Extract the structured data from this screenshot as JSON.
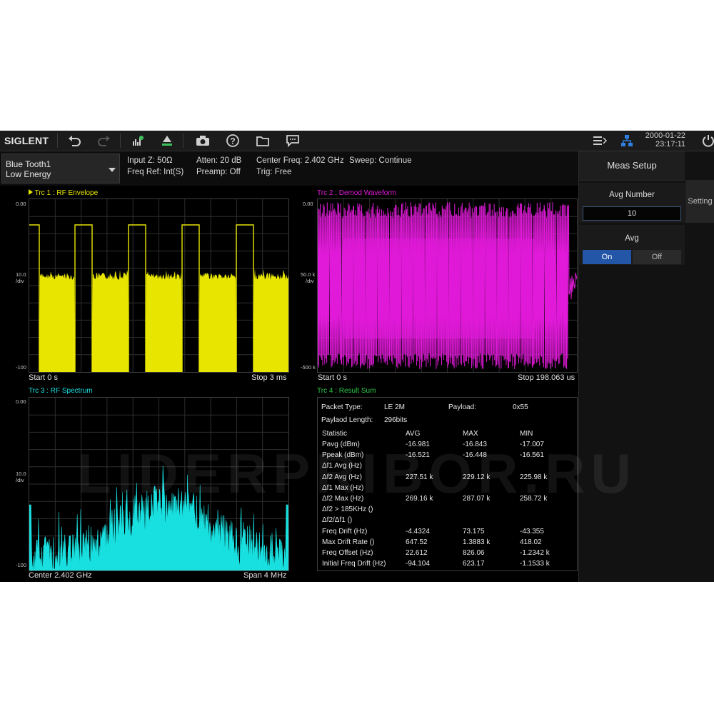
{
  "toolbar": {
    "brand": "SIGLENT",
    "icons": [
      "undo-icon",
      "redo-icon",
      "peak-search-icon",
      "marker-icon",
      "camera-icon",
      "help-icon",
      "folder-icon",
      "message-icon",
      "menu-list-icon",
      "network-icon",
      "power-icon"
    ],
    "date": "2000-01-22",
    "time": "23:17:11"
  },
  "mode": {
    "line1": "Blue Tooth1",
    "line2": "Low Energy"
  },
  "info": {
    "input_z": "Input Z: 50Ω",
    "freq_ref": "Freq Ref: Int(S)",
    "atten": "Atten: 20 dB",
    "preamp": "Preamp: Off",
    "center_freq": "Center Freq: 2.402 GHz",
    "sweep": "Sweep: Continue",
    "trig": "Trig: Free"
  },
  "meas_setup": {
    "title": "Meas Setup",
    "tab": "Setting",
    "avg_number_label": "Avg Number",
    "avg_number_value": "10",
    "avg_label": "Avg",
    "avg_on": "On",
    "avg_off": "Off",
    "avg_state": "On"
  },
  "trace1": {
    "title": "Trc 1 :  RF Envelope",
    "color": "#e8e600",
    "ytop": "0.00",
    "ymid": "10.0",
    "ydiv": "/div",
    "ybot": "-100",
    "start": "Start 0 s",
    "stop": "Stop 3 ms"
  },
  "trace2": {
    "title": "Trc 2 :  Demod Waveform",
    "color": "#e01ad8",
    "ytop": "0.00",
    "ymid": "50.0 k",
    "ydiv": "/div",
    "ybot": "-500 k",
    "start": "Start 0 s",
    "stop": "Stop 198.063 us"
  },
  "trace3": {
    "title": "Trc 3 :  RF Spectrum",
    "color": "#19e0e0",
    "ytop": "0.00",
    "ymid": "10.0",
    "ydiv": "/div",
    "ybot": "-100",
    "center": "Center 2.402 GHz",
    "span": "Span 4 MHz"
  },
  "trace4": {
    "title": "Trc 4 :  Result Sum",
    "color": "#2ec84a",
    "packet_type_label": "Packet Type:",
    "packet_type_value": "LE 2M",
    "payload_label": "Payload:",
    "payload_value": "0x55",
    "payload_length_label": "Paylaod Length:",
    "payload_length_value": "296bits",
    "header": [
      "Statistic",
      "AVG",
      "MAX",
      "MIN"
    ],
    "rows": [
      [
        "Pavg (dBm)",
        "-16.981",
        "-16.843",
        "-17.007"
      ],
      [
        "Ppeak (dBm)",
        "-16.521",
        "-16.448",
        "-16.561"
      ],
      [
        "Δf1 Avg (Hz)",
        "",
        "",
        ""
      ],
      [
        "Δf2 Avg (Hz)",
        "227.51 k",
        "229.12 k",
        "225.98 k"
      ],
      [
        "Δf1 Max (Hz)",
        "",
        "",
        ""
      ],
      [
        "Δf2 Max (Hz)",
        "269.16 k",
        "287.07 k",
        "258.72 k"
      ],
      [
        "Δf2 > 185KHz ()",
        "",
        "",
        ""
      ],
      [
        "Δf2/Δf1 ()",
        "",
        "",
        ""
      ],
      [
        "Freq Drift (Hz)",
        "-4.4324",
        "73.175",
        "-43.355"
      ],
      [
        "Max Drift Rate ()",
        "647.52",
        "1.3883 k",
        "418.02"
      ],
      [
        "Freq Offset (Hz)",
        "22.612",
        "826.06",
        "-1.2342 k"
      ],
      [
        "Initial Freq Drift (Hz)",
        "-94.104",
        "623.17",
        "-1.1533 k"
      ]
    ]
  },
  "watermark": "LIDERPRIBOR.RU"
}
